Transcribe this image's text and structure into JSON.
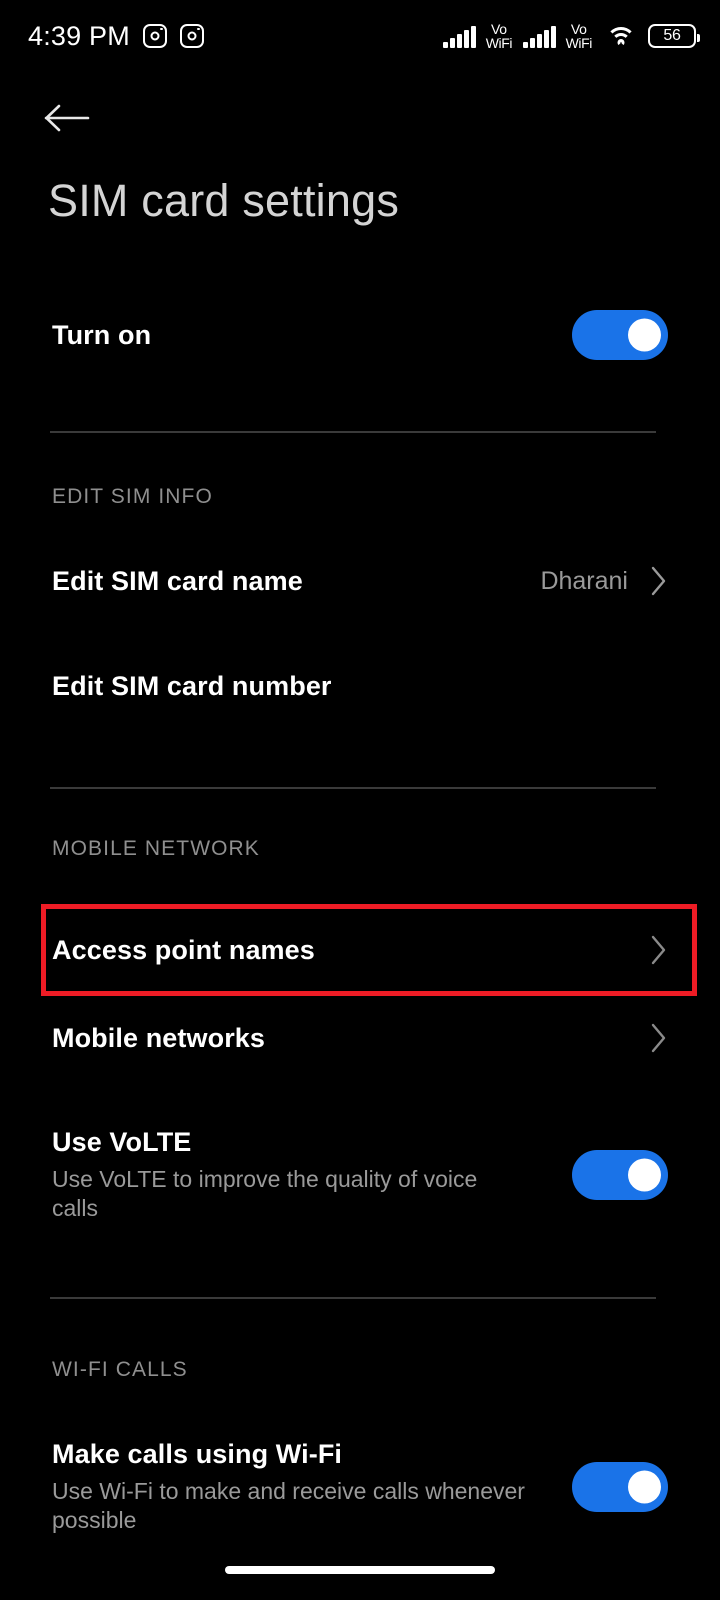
{
  "status_bar": {
    "time": "4:39 PM",
    "notification_icons": [
      "instagram-icon",
      "instagram-icon"
    ],
    "signal_1": "signal-bars-icon",
    "volte_1_line1": "Vo",
    "volte_1_line2": "WiFi",
    "signal_2": "signal-bars-icon",
    "volte_2_line1": "Vo",
    "volte_2_line2": "WiFi",
    "wifi": "wifi-icon",
    "battery_percent": "56"
  },
  "header": {
    "back_icon": "back-arrow-icon",
    "title": "SIM card settings"
  },
  "colors": {
    "background": "#000000",
    "toggle_on": "#1a73e8",
    "highlight": "#ee1c25",
    "title_text": "#d4d4d4",
    "secondary_text": "#9a9a9a",
    "divider": "#3a3a3a"
  },
  "rows": {
    "turn_on": {
      "title": "Turn on",
      "toggle_state": "on"
    }
  },
  "sections": [
    {
      "label": "EDIT SIM INFO",
      "items": [
        {
          "title": "Edit SIM card name",
          "value": "Dharani",
          "chevron": true
        },
        {
          "title": "Edit SIM card number",
          "value": "",
          "chevron": false
        }
      ]
    },
    {
      "label": "MOBILE NETWORK",
      "items": [
        {
          "title": "Access point names",
          "chevron": true,
          "highlighted": true
        },
        {
          "title": "Mobile networks",
          "chevron": true
        },
        {
          "title": "Use VoLTE",
          "subtitle": "Use VoLTE to improve the quality of voice calls",
          "toggle_state": "on"
        }
      ]
    },
    {
      "label": "WI-FI CALLS",
      "items": [
        {
          "title": "Make calls using Wi-Fi",
          "subtitle": "Use Wi-Fi to make and receive calls whenever possible",
          "toggle_state": "on"
        }
      ]
    }
  ]
}
